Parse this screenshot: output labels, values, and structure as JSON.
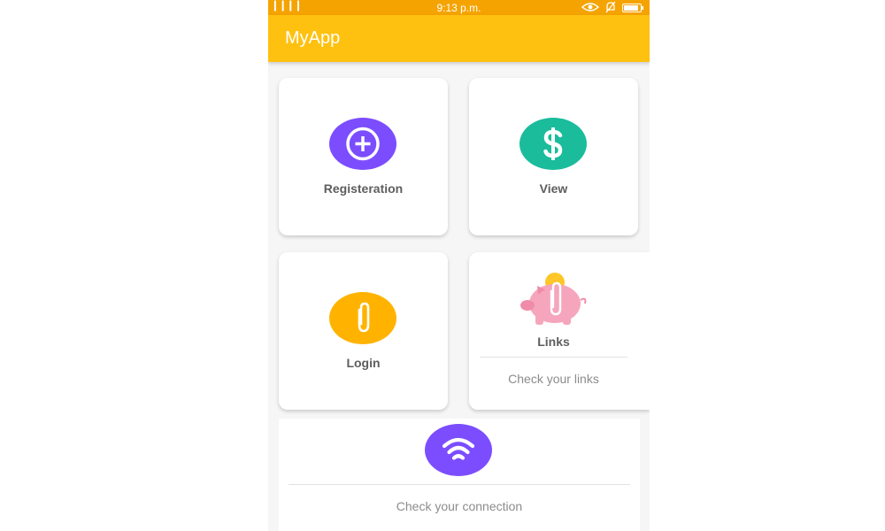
{
  "status_bar": {
    "signal": "▎▎▎▎",
    "time": "9:13 p.m."
  },
  "app_bar": {
    "title": "MyApp"
  },
  "tiles": {
    "registration": {
      "label": "Registeration",
      "icon": "plus-circle-icon",
      "color": "#7c4dff"
    },
    "view": {
      "label": "View",
      "icon": "dollar-icon",
      "color": "#1abc9c"
    },
    "login": {
      "label": "Login",
      "icon": "paperclip-icon",
      "color": "#ffb300"
    },
    "links": {
      "label": "Links",
      "subtitle": "Check your links",
      "icon": "piggy-bank-icon"
    },
    "connection": {
      "subtitle": "Check your connection",
      "icon": "wifi-icon",
      "color": "#7c4dff"
    }
  }
}
